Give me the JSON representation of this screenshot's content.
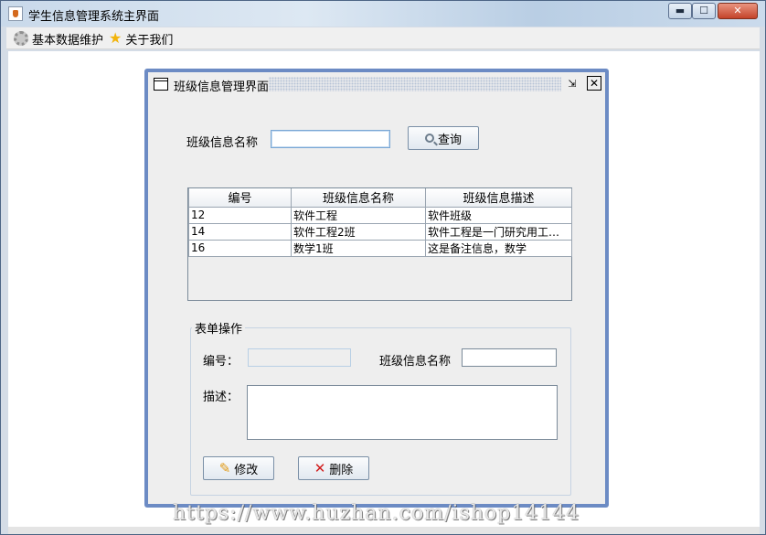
{
  "window": {
    "title": "学生信息管理系统主界面",
    "min_glyph": "▬",
    "max_glyph": "☐",
    "close_glyph": "✕"
  },
  "menubar": {
    "items": [
      {
        "label": "基本数据维护",
        "icon": "gear-icon"
      },
      {
        "label": "关于我们",
        "icon": "star-icon"
      }
    ]
  },
  "internal_frame": {
    "title": "班级信息管理界面",
    "iconify_glyph": "⇲",
    "close_glyph": "✕",
    "search": {
      "label": "班级信息名称",
      "value": "",
      "button_label": "查询"
    },
    "table": {
      "columns": [
        "编号",
        "班级信息名称",
        "班级信息描述"
      ],
      "rows": [
        [
          "12",
          "软件工程",
          "软件班级"
        ],
        [
          "14",
          "软件工程2班",
          "软件工程是一门研究用工程化方法构建和维护有效的"
        ],
        [
          "16",
          "数学1班",
          "这是备注信息，数学"
        ]
      ]
    },
    "form": {
      "title": "表单操作",
      "id_label": "编号：",
      "id_value": "",
      "name_label": "班级信息名称",
      "name_value": "",
      "desc_label": "描述：",
      "desc_value": "",
      "edit_label": "修改",
      "delete_label": "删除"
    }
  },
  "watermark": "https://www.huzhan.com/ishop14144",
  "colors": {
    "frame_border": "#6c8bc4",
    "delete_icon": "#d11c1c",
    "edit_icon": "#e19a16",
    "star_icon": "#f2b40c"
  }
}
